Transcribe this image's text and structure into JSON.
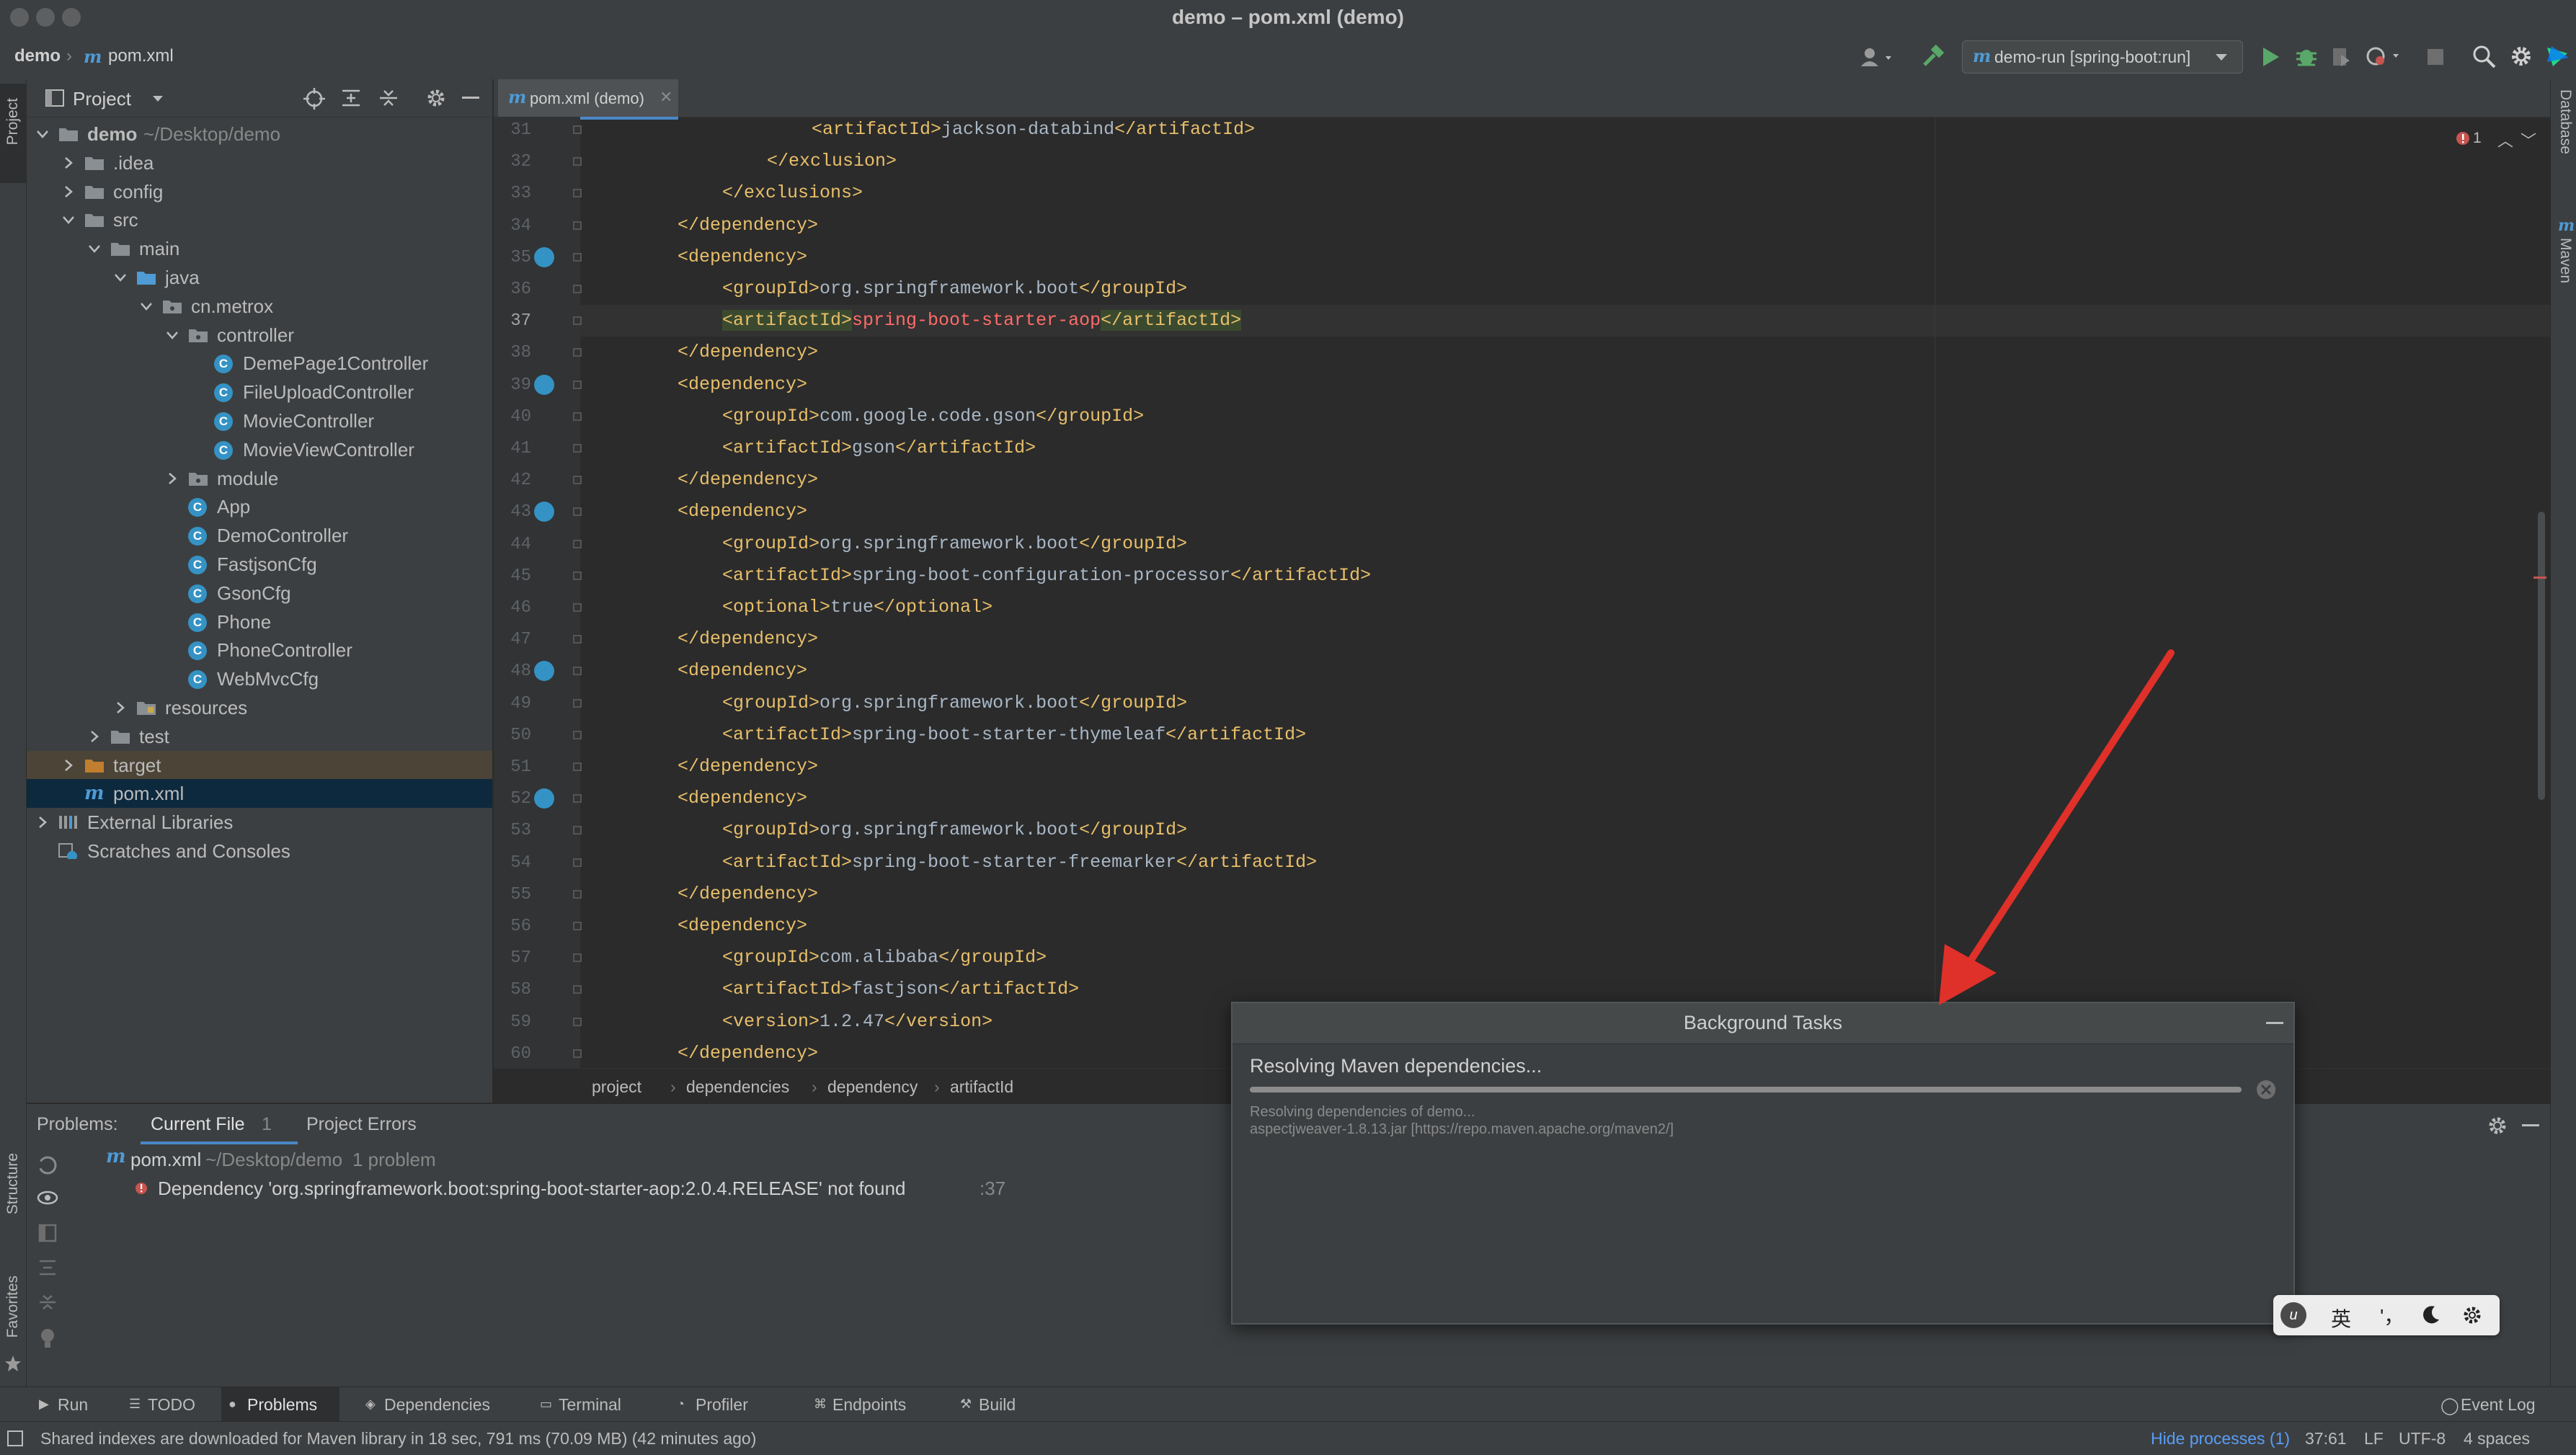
{
  "window": {
    "title": "demo – pom.xml (demo)"
  },
  "nav": {
    "project": "demo",
    "file": "pom.xml",
    "file_prefix": "m",
    "run_config": "demo-run [spring-boot:run]"
  },
  "left_strip": {
    "project": "Project",
    "structure": "Structure",
    "favorites": "Favorites"
  },
  "right_strip": {
    "database": "Database",
    "maven": "Maven"
  },
  "project_panel": {
    "title": "Project"
  },
  "tree": [
    {
      "label": "demo",
      "suffix": "~/Desktop/demo",
      "depth": 0,
      "kind": "module",
      "arrow": "down"
    },
    {
      "label": ".idea",
      "depth": 1,
      "kind": "folder",
      "arrow": "right"
    },
    {
      "label": "config",
      "depth": 1,
      "kind": "folder",
      "arrow": "right"
    },
    {
      "label": "src",
      "depth": 1,
      "kind": "folder",
      "arrow": "down"
    },
    {
      "label": "main",
      "depth": 2,
      "kind": "folder",
      "arrow": "down"
    },
    {
      "label": "java",
      "depth": 3,
      "kind": "source",
      "arrow": "down"
    },
    {
      "label": "cn.metrox",
      "depth": 4,
      "kind": "package",
      "arrow": "down"
    },
    {
      "label": "controller",
      "depth": 5,
      "kind": "package",
      "arrow": "down"
    },
    {
      "label": "DemePage1Controller",
      "depth": 6,
      "kind": "class"
    },
    {
      "label": "FileUploadController",
      "depth": 6,
      "kind": "class"
    },
    {
      "label": "MovieController",
      "depth": 6,
      "kind": "class"
    },
    {
      "label": "MovieViewController",
      "depth": 6,
      "kind": "class"
    },
    {
      "label": "module",
      "depth": 5,
      "kind": "package",
      "arrow": "right"
    },
    {
      "label": "App",
      "depth": 5,
      "kind": "class"
    },
    {
      "label": "DemoController",
      "depth": 5,
      "kind": "class"
    },
    {
      "label": "FastjsonCfg",
      "depth": 5,
      "kind": "class"
    },
    {
      "label": "GsonCfg",
      "depth": 5,
      "kind": "class"
    },
    {
      "label": "Phone",
      "depth": 5,
      "kind": "class"
    },
    {
      "label": "PhoneController",
      "depth": 5,
      "kind": "class"
    },
    {
      "label": "WebMvcCfg",
      "depth": 5,
      "kind": "class"
    },
    {
      "label": "resources",
      "depth": 3,
      "kind": "resfolder",
      "arrow": "right"
    },
    {
      "label": "test",
      "depth": 2,
      "kind": "folder",
      "arrow": "right"
    },
    {
      "label": "target",
      "depth": 1,
      "kind": "target",
      "arrow": "right"
    },
    {
      "label": "pom.xml",
      "depth": 1,
      "kind": "maven"
    },
    {
      "label": "External Libraries",
      "depth": 0,
      "kind": "libs",
      "arrow": "right"
    },
    {
      "label": "Scratches and Consoles",
      "depth": 0,
      "kind": "scratch"
    }
  ],
  "editor": {
    "tab_label": "pom.xml (demo)",
    "error_count": "1",
    "current_line": "37",
    "lines": [
      {
        "n": "31",
        "indent": 3,
        "parts": [
          [
            "tag",
            "<artifactId>"
          ],
          [
            "txt",
            "jackson-databind"
          ],
          [
            "tag",
            "</artifactId>"
          ]
        ]
      },
      {
        "n": "32",
        "indent": 2,
        "parts": [
          [
            "tag",
            "</exclusion>"
          ]
        ]
      },
      {
        "n": "33",
        "indent": 1,
        "parts": [
          [
            "tag",
            "</exclusions>"
          ]
        ]
      },
      {
        "n": "34",
        "indent": 0,
        "parts": [
          [
            "tag",
            "</dependency>"
          ]
        ]
      },
      {
        "n": "35",
        "indent": 0,
        "parts": [
          [
            "tag",
            "<dependency>"
          ]
        ],
        "marker": true
      },
      {
        "n": "36",
        "indent": 1,
        "parts": [
          [
            "tag",
            "<groupId>"
          ],
          [
            "txt",
            "org.springframework.boot"
          ],
          [
            "tag",
            "</groupId>"
          ]
        ]
      },
      {
        "n": "37",
        "indent": 1,
        "parts": [
          [
            "hltag",
            "<artifactId>"
          ],
          [
            "err",
            "spring-boot-starter-aop"
          ],
          [
            "hltag",
            "</artifactId>"
          ]
        ]
      },
      {
        "n": "38",
        "indent": 0,
        "parts": [
          [
            "tag",
            "</dependency>"
          ]
        ]
      },
      {
        "n": "39",
        "indent": 0,
        "parts": [
          [
            "tag",
            "<dependency>"
          ]
        ],
        "marker": true
      },
      {
        "n": "40",
        "indent": 1,
        "parts": [
          [
            "tag",
            "<groupId>"
          ],
          [
            "txt",
            "com.google.code.gson"
          ],
          [
            "tag",
            "</groupId>"
          ]
        ]
      },
      {
        "n": "41",
        "indent": 1,
        "parts": [
          [
            "tag",
            "<artifactId>"
          ],
          [
            "txt",
            "gson"
          ],
          [
            "tag",
            "</artifactId>"
          ]
        ]
      },
      {
        "n": "42",
        "indent": 0,
        "parts": [
          [
            "tag",
            "</dependency>"
          ]
        ]
      },
      {
        "n": "43",
        "indent": 0,
        "parts": [
          [
            "tag",
            "<dependency>"
          ]
        ],
        "marker": true
      },
      {
        "n": "44",
        "indent": 1,
        "parts": [
          [
            "tag",
            "<groupId>"
          ],
          [
            "txt",
            "org.springframework.boot"
          ],
          [
            "tag",
            "</groupId>"
          ]
        ]
      },
      {
        "n": "45",
        "indent": 1,
        "parts": [
          [
            "tag",
            "<artifactId>"
          ],
          [
            "txt",
            "spring-boot-configuration-processor"
          ],
          [
            "tag",
            "</artifactId>"
          ]
        ]
      },
      {
        "n": "46",
        "indent": 1,
        "parts": [
          [
            "tag",
            "<optional>"
          ],
          [
            "txt",
            "true"
          ],
          [
            "tag",
            "</optional>"
          ]
        ]
      },
      {
        "n": "47",
        "indent": 0,
        "parts": [
          [
            "tag",
            "</dependency>"
          ]
        ]
      },
      {
        "n": "48",
        "indent": 0,
        "parts": [
          [
            "tag",
            "<dependency>"
          ]
        ],
        "marker": true
      },
      {
        "n": "49",
        "indent": 1,
        "parts": [
          [
            "tag",
            "<groupId>"
          ],
          [
            "txt",
            "org.springframework.boot"
          ],
          [
            "tag",
            "</groupId>"
          ]
        ]
      },
      {
        "n": "50",
        "indent": 1,
        "parts": [
          [
            "tag",
            "<artifactId>"
          ],
          [
            "txt",
            "spring-boot-starter-thymeleaf"
          ],
          [
            "tag",
            "</artifactId>"
          ]
        ]
      },
      {
        "n": "51",
        "indent": 0,
        "parts": [
          [
            "tag",
            "</dependency>"
          ]
        ]
      },
      {
        "n": "52",
        "indent": 0,
        "parts": [
          [
            "tag",
            "<dependency>"
          ]
        ],
        "marker": true
      },
      {
        "n": "53",
        "indent": 1,
        "parts": [
          [
            "tag",
            "<groupId>"
          ],
          [
            "txt",
            "org.springframework.boot"
          ],
          [
            "tag",
            "</groupId>"
          ]
        ]
      },
      {
        "n": "54",
        "indent": 1,
        "parts": [
          [
            "tag",
            "<artifactId>"
          ],
          [
            "txt",
            "spring-boot-starter-freemarker"
          ],
          [
            "tag",
            "</artifactId>"
          ]
        ]
      },
      {
        "n": "55",
        "indent": 0,
        "parts": [
          [
            "tag",
            "</dependency>"
          ]
        ]
      },
      {
        "n": "56",
        "indent": 0,
        "parts": [
          [
            "tag",
            "<dependency>"
          ]
        ]
      },
      {
        "n": "57",
        "indent": 1,
        "parts": [
          [
            "tag",
            "<groupId>"
          ],
          [
            "txt",
            "com.alibaba"
          ],
          [
            "tag",
            "</groupId>"
          ]
        ]
      },
      {
        "n": "58",
        "indent": 1,
        "parts": [
          [
            "tag",
            "<artifactId>"
          ],
          [
            "txt",
            "fastjson"
          ],
          [
            "tag",
            "</artifactId>"
          ]
        ]
      },
      {
        "n": "59",
        "indent": 1,
        "parts": [
          [
            "tag",
            "<version>"
          ],
          [
            "txt",
            "1.2.47"
          ],
          [
            "tag",
            "</version>"
          ]
        ]
      },
      {
        "n": "60",
        "indent": 0,
        "parts": [
          [
            "tag",
            "</dependency>"
          ]
        ]
      }
    ]
  },
  "breadcrumb": [
    "project",
    "dependencies",
    "dependency",
    "artifactId"
  ],
  "problems": {
    "label": "Problems:",
    "tab_current": "Current File",
    "tab_current_count": "1",
    "tab_project": "Project Errors",
    "file": "pom.xml",
    "file_path": "~/Desktop/demo",
    "file_count": "1 problem",
    "message": "Dependency 'org.springframework.boot:spring-boot-starter-aop:2.0.4.RELEASE' not found",
    "message_line": ":37"
  },
  "background_tasks": {
    "title": "Background Tasks",
    "task": "Resolving Maven dependencies...",
    "detail1": "Resolving dependencies of demo...",
    "detail2": "aspectjweaver-1.8.13.jar [https://repo.maven.apache.org/maven2/]",
    "progress": 1.0
  },
  "toolwindows": [
    "Run",
    "TODO",
    "Problems",
    "Dependencies",
    "Terminal",
    "Profiler",
    "Endpoints",
    "Build"
  ],
  "event_log": "Event Log",
  "status": {
    "message": "Shared indexes are downloaded for Maven library in 18 sec, 791 ms (70.09 MB) (42 minutes ago)",
    "hide_processes": "Hide processes (1)",
    "position": "37:61",
    "line_sep": "LF",
    "encoding": "UTF-8",
    "indent": "4 spaces"
  },
  "ime": {
    "lang": "英",
    "punct": "'，"
  },
  "colors": {
    "accent": "#4a88c7",
    "tag": "#e8bf6a",
    "text": "#a9b7c6",
    "error": "#ff6b68",
    "annotation_arrow": "#e0302a"
  }
}
